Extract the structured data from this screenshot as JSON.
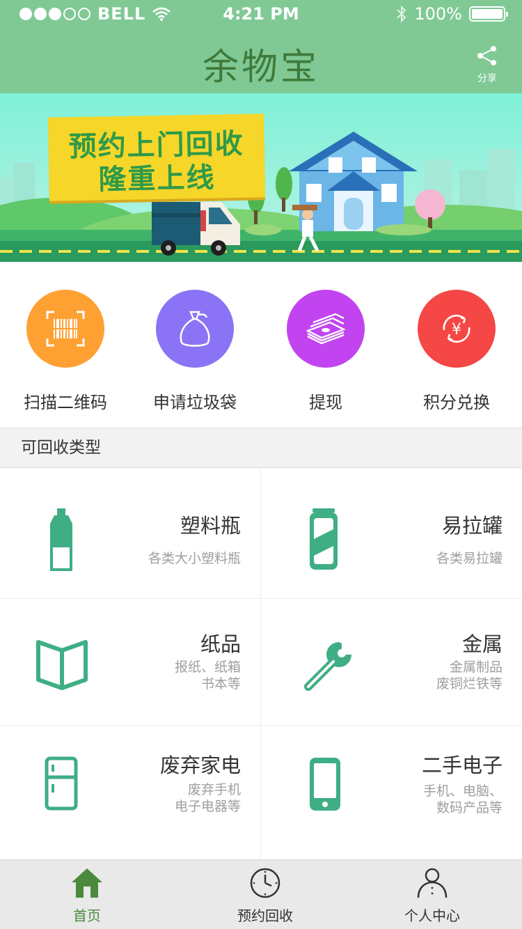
{
  "status_bar": {
    "carrier": "BELL",
    "time": "4:21 PM",
    "battery": "100%"
  },
  "header": {
    "logo": "余物宝",
    "share_label": "分享"
  },
  "banner": {
    "line1": "预约上门回收",
    "line2": "隆重上线"
  },
  "quick_actions": [
    {
      "label": "扫描二维码",
      "icon": "barcode-icon",
      "color": "#ffa033"
    },
    {
      "label": "申请垃圾袋",
      "icon": "bag-icon",
      "color": "#8b73f5"
    },
    {
      "label": "提现",
      "icon": "money-icon",
      "color": "#c244f0"
    },
    {
      "label": "积分兑换",
      "icon": "exchange-icon",
      "color": "#f54745"
    }
  ],
  "section": {
    "title": "可回收类型"
  },
  "categories": [
    {
      "title": "塑料瓶",
      "desc1": "各类大小塑料瓶",
      "desc2": "",
      "icon": "bottle-icon"
    },
    {
      "title": "易拉罐",
      "desc1": "各类易拉罐",
      "desc2": "",
      "icon": "can-icon"
    },
    {
      "title": "纸品",
      "desc1": "报纸、纸箱",
      "desc2": "书本等",
      "icon": "book-icon"
    },
    {
      "title": "金属",
      "desc1": "金属制品",
      "desc2": "废铜烂铁等",
      "icon": "wrench-icon"
    },
    {
      "title": "废弃家电",
      "desc1": "废弃手机",
      "desc2": "电子电器等",
      "icon": "fridge-icon"
    },
    {
      "title": "二手电子",
      "desc1": "手机、电脑、",
      "desc2": "数码产品等",
      "icon": "phone-icon"
    }
  ],
  "tabs": [
    {
      "label": "首页",
      "icon": "home-icon"
    },
    {
      "label": "预约回收",
      "icon": "clock-icon"
    },
    {
      "label": "个人中心",
      "icon": "user-icon"
    }
  ],
  "colors": {
    "brand": "#80c995",
    "accent": "#3fae84",
    "active_tab": "#4b8a3d"
  }
}
